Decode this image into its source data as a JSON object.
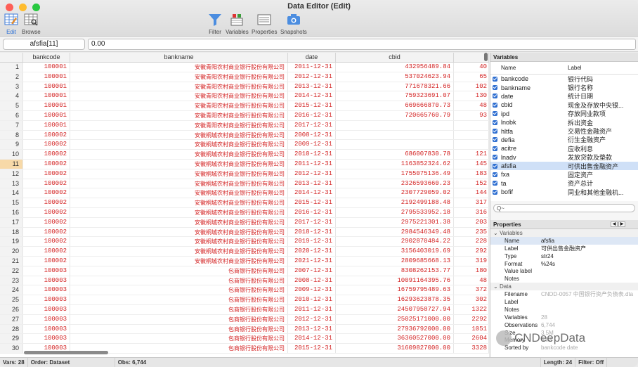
{
  "window": {
    "title": "Data Editor (Edit)"
  },
  "toolbar": {
    "edit": "Edit",
    "browse": "Browse",
    "filter": "Filter",
    "variables": "Variables",
    "properties": "Properties",
    "snapshots": "Snapshots"
  },
  "varbar": {
    "name": "afsfia[11]",
    "value": "0.00"
  },
  "grid": {
    "headers": [
      "bankcode",
      "bankname",
      "date",
      "cbid"
    ],
    "rows": [
      [
        "1",
        "100001",
        "安徽青阳农村商业银行股份有限公司",
        "2011-12-31",
        "432956489.84",
        "40"
      ],
      [
        "2",
        "100001",
        "安徽青阳农村商业银行股份有限公司",
        "2012-12-31",
        "537024623.94",
        "65"
      ],
      [
        "3",
        "100001",
        "安徽青阳农村商业银行股份有限公司",
        "2013-12-31",
        "771678321.66",
        "102"
      ],
      [
        "4",
        "100001",
        "安徽青阳农村商业银行股份有限公司",
        "2014-12-31",
        "759323691.07",
        "130"
      ],
      [
        "5",
        "100001",
        "安徽青阳农村商业银行股份有限公司",
        "2015-12-31",
        "669666870.73",
        "48"
      ],
      [
        "6",
        "100001",
        "安徽青阳农村商业银行股份有限公司",
        "2016-12-31",
        "720665760.79",
        "93"
      ],
      [
        "7",
        "100001",
        "安徽青阳农村商业银行股份有限公司",
        "2017-12-31",
        "",
        ""
      ],
      [
        "8",
        "100002",
        "安徽桐城农村商业银行股份有限公司",
        "2008-12-31",
        "",
        ""
      ],
      [
        "9",
        "100002",
        "安徽桐城农村商业银行股份有限公司",
        "2009-12-31",
        "",
        ""
      ],
      [
        "10",
        "100002",
        "安徽桐城农村商业银行股份有限公司",
        "2010-12-31",
        "686007830.78",
        "121"
      ],
      [
        "11",
        "100002",
        "安徽桐城农村商业银行股份有限公司",
        "2011-12-31",
        "1163852324.62",
        "145"
      ],
      [
        "12",
        "100002",
        "安徽桐城农村商业银行股份有限公司",
        "2012-12-31",
        "1755075136.49",
        "183"
      ],
      [
        "13",
        "100002",
        "安徽桐城农村商业银行股份有限公司",
        "2013-12-31",
        "2326593660.23",
        "152"
      ],
      [
        "14",
        "100002",
        "安徽桐城农村商业银行股份有限公司",
        "2014-12-31",
        "2307729059.02",
        "144"
      ],
      [
        "15",
        "100002",
        "安徽桐城农村商业银行股份有限公司",
        "2015-12-31",
        "2192499188.48",
        "317"
      ],
      [
        "16",
        "100002",
        "安徽桐城农村商业银行股份有限公司",
        "2016-12-31",
        "2795533952.18",
        "316"
      ],
      [
        "17",
        "100002",
        "安徽桐城农村商业银行股份有限公司",
        "2017-12-31",
        "2975221301.38",
        "203"
      ],
      [
        "18",
        "100002",
        "安徽桐城农村商业银行股份有限公司",
        "2018-12-31",
        "2984546349.48",
        "235"
      ],
      [
        "19",
        "100002",
        "安徽桐城农村商业银行股份有限公司",
        "2019-12-31",
        "2902870484.22",
        "228"
      ],
      [
        "20",
        "100002",
        "安徽桐城农村商业银行股份有限公司",
        "2020-12-31",
        "3156403019.69",
        "292"
      ],
      [
        "21",
        "100002",
        "安徽桐城农村商业银行股份有限公司",
        "2021-12-31",
        "2809685668.13",
        "319"
      ],
      [
        "22",
        "100003",
        "包商银行股份有限公司",
        "2007-12-31",
        "8308262153.77",
        "180"
      ],
      [
        "23",
        "100003",
        "包商银行股份有限公司",
        "2008-12-31",
        "10091164395.76",
        "48"
      ],
      [
        "24",
        "100003",
        "包商银行股份有限公司",
        "2009-12-31",
        "16759795489.63",
        "372"
      ],
      [
        "25",
        "100003",
        "包商银行股份有限公司",
        "2010-12-31",
        "16293623878.35",
        "302"
      ],
      [
        "26",
        "100003",
        "包商银行股份有限公司",
        "2011-12-31",
        "24507958727.94",
        "1322"
      ],
      [
        "27",
        "100003",
        "包商银行股份有限公司",
        "2012-12-31",
        "25025171000.00",
        "2292"
      ],
      [
        "28",
        "100003",
        "包商银行股份有限公司",
        "2013-12-31",
        "27936792000.00",
        "1051"
      ],
      [
        "29",
        "100003",
        "包商银行股份有限公司",
        "2014-12-31",
        "36360527000.00",
        "2604"
      ],
      [
        "30",
        "100003",
        "包商银行股份有限公司",
        "2015-12-31",
        "31609827000.00",
        "3328"
      ]
    ]
  },
  "variables": {
    "title": "Variables",
    "col_name": "Name",
    "col_label": "Label",
    "items": [
      {
        "name": "bankcode",
        "label": "银行代码"
      },
      {
        "name": "bankname",
        "label": "银行名称"
      },
      {
        "name": "date",
        "label": "统计日期"
      },
      {
        "name": "cbid",
        "label": "现金及存放中央银..."
      },
      {
        "name": "ipd",
        "label": "存放同业款项"
      },
      {
        "name": "lnobk",
        "label": "拆出资金"
      },
      {
        "name": "hltfa",
        "label": "交易性金融资产"
      },
      {
        "name": "defia",
        "label": "衍生金融资产"
      },
      {
        "name": "acitre",
        "label": "应收利息"
      },
      {
        "name": "lnadv",
        "label": "发放贷款及垫款"
      },
      {
        "name": "afsfia",
        "label": "可供出售金融资产"
      },
      {
        "name": "fxa",
        "label": "固定资产"
      },
      {
        "name": "ta",
        "label": "资产总计"
      },
      {
        "name": "bofif",
        "label": "同业和其他金融机..."
      }
    ],
    "search_placeholder": "Q~"
  },
  "properties": {
    "title": "Properties",
    "sec_variables": "Variables",
    "var_rows": [
      {
        "k": "Name",
        "v": "afsfia"
      },
      {
        "k": "Label",
        "v": "可供出售金融资产"
      },
      {
        "k": "Type",
        "v": "str24"
      },
      {
        "k": "Format",
        "v": "%24s"
      },
      {
        "k": "Value label",
        "v": ""
      },
      {
        "k": "Notes",
        "v": ""
      }
    ],
    "sec_data": "Data",
    "data_rows": [
      {
        "k": "Filename",
        "v": "CNDD-0057 中国银行资产负债表.dta"
      },
      {
        "k": "Label",
        "v": ""
      },
      {
        "k": "Notes",
        "v": ""
      },
      {
        "k": "Variables",
        "v": "28"
      },
      {
        "k": "Observations",
        "v": "6,744"
      },
      {
        "k": "Size",
        "v": "3.5M"
      },
      {
        "k": "Memory",
        "v": "64M"
      },
      {
        "k": "Sorted by",
        "v": "bankcode date"
      }
    ]
  },
  "status": {
    "vars": "Vars: 28",
    "order": "Order: Dataset",
    "obs": "Obs: 6,744",
    "length": "Length: 24",
    "filter": "Filter: Off"
  },
  "watermark": {
    "text": "CNDeepData"
  }
}
